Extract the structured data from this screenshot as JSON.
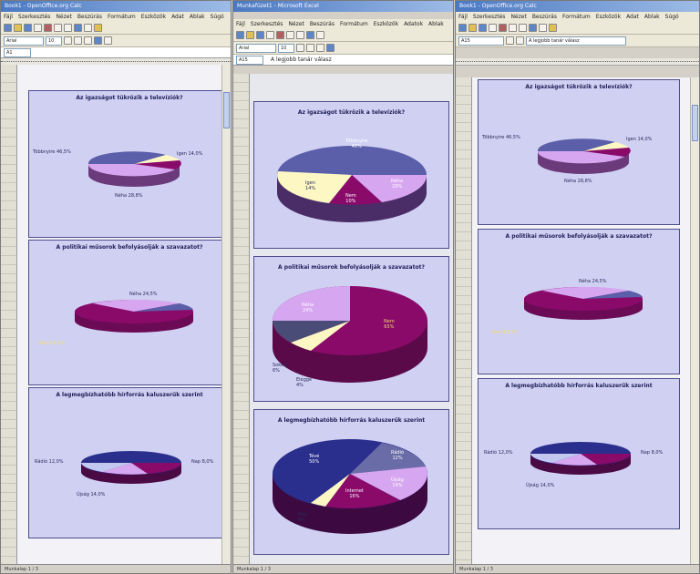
{
  "windows": [
    {
      "id": "left",
      "title": "Book1 - OpenOffice.org Calc",
      "menu": [
        "Fájl",
        "Szerkesztés",
        "Nézet",
        "Beszúrás",
        "Formátum",
        "Eszközök",
        "Adat",
        "Ablak",
        "Súgó"
      ],
      "font_name": "Arial",
      "font_size": "10",
      "cell_ref": "A1",
      "formula": ""
    },
    {
      "id": "middle",
      "title": "Munkafüzet1 - Microsoft Excel",
      "menu": [
        "Fájl",
        "Szerkesztés",
        "Nézet",
        "Beszúrás",
        "Formátum",
        "Eszközök",
        "Adatok",
        "Ablak"
      ],
      "font_name": "Arial",
      "font_size": "10",
      "cell_ref": "A15",
      "formula": "A legjobb tanár válasz"
    },
    {
      "id": "right",
      "title": "Book1 - OpenOffice.org Calc",
      "menu": [
        "Fájl",
        "Szerkesztés",
        "Nézet",
        "Beszúrás",
        "Formátum",
        "Eszközök",
        "Adat",
        "Ablak",
        "Súgó"
      ],
      "font_name": "Arial",
      "font_size": "10",
      "cell_ref": "A15",
      "formula": "A legjobb tanár válasz"
    }
  ],
  "charts": {
    "c1": {
      "title": "Az igazságot tükrözik a televíziók?",
      "slices": [
        {
          "name": "Többnyire",
          "pct": "46,5%"
        },
        {
          "name": "Igen",
          "pct": "14,0%"
        },
        {
          "name": "Nem",
          "pct": "10,7%"
        },
        {
          "name": "Néha",
          "pct": "28,8%"
        }
      ]
    },
    "c2": {
      "title": "A politikai műsorok befolyásolják a szavazatot?",
      "slices": [
        {
          "name": "Néha",
          "pct": "24,5%"
        },
        {
          "name": "Nem",
          "pct": "65,0%"
        },
        {
          "name": "Eléggé",
          "pct": "4,5%"
        },
        {
          "name": "Sokkal",
          "pct": "6,0%"
        }
      ]
    },
    "c3": {
      "title": "A legmegbízhatóbb hírforrás kaluszerűk szerint",
      "slices": [
        {
          "name": "Rádió",
          "pct": "12,0%"
        },
        {
          "name": "Tévé",
          "pct": "50,0%"
        },
        {
          "name": "Nap",
          "pct": "8,0%"
        },
        {
          "name": "Újság",
          "pct": "14,0%"
        },
        {
          "name": "Internet",
          "pct": "16,0%"
        }
      ]
    },
    "m1": {
      "title": "Az igazságot tükrözik a televíziók?",
      "labels": [
        "Többnyire\n46%",
        "Néha\n29%",
        "Nem\n10%",
        "Igen\n14%"
      ]
    },
    "m2": {
      "title": "A politikai műsorok befolyásolják a szavazatot?",
      "labels": [
        "Néha\n24%",
        "Nem\n65%",
        "Sokkal\n6%",
        "Eléggé\n4%"
      ]
    },
    "m3": {
      "title": "A legmegbízhatóbb hírforrás kaluszerűk szerint",
      "labels": [
        "Tévé\n50%",
        "Rádió\n12%",
        "Újság\n14%",
        "Internet\n16%",
        "Nap\n8%"
      ]
    }
  },
  "status": {
    "left": "Munkalap 1 / 3",
    "middle": "Munkalap 1 / 3",
    "right": "Munkalap 1 / 3"
  },
  "colors": {
    "chart_bg": "#cfd0f2",
    "blue": "#5b5ea8",
    "violet": "#d7a6f0",
    "magenta": "#8a0a6a",
    "cream": "#fdf7c4",
    "navy": "#2a2e8c",
    "lightblue": "#c3c8f0"
  }
}
